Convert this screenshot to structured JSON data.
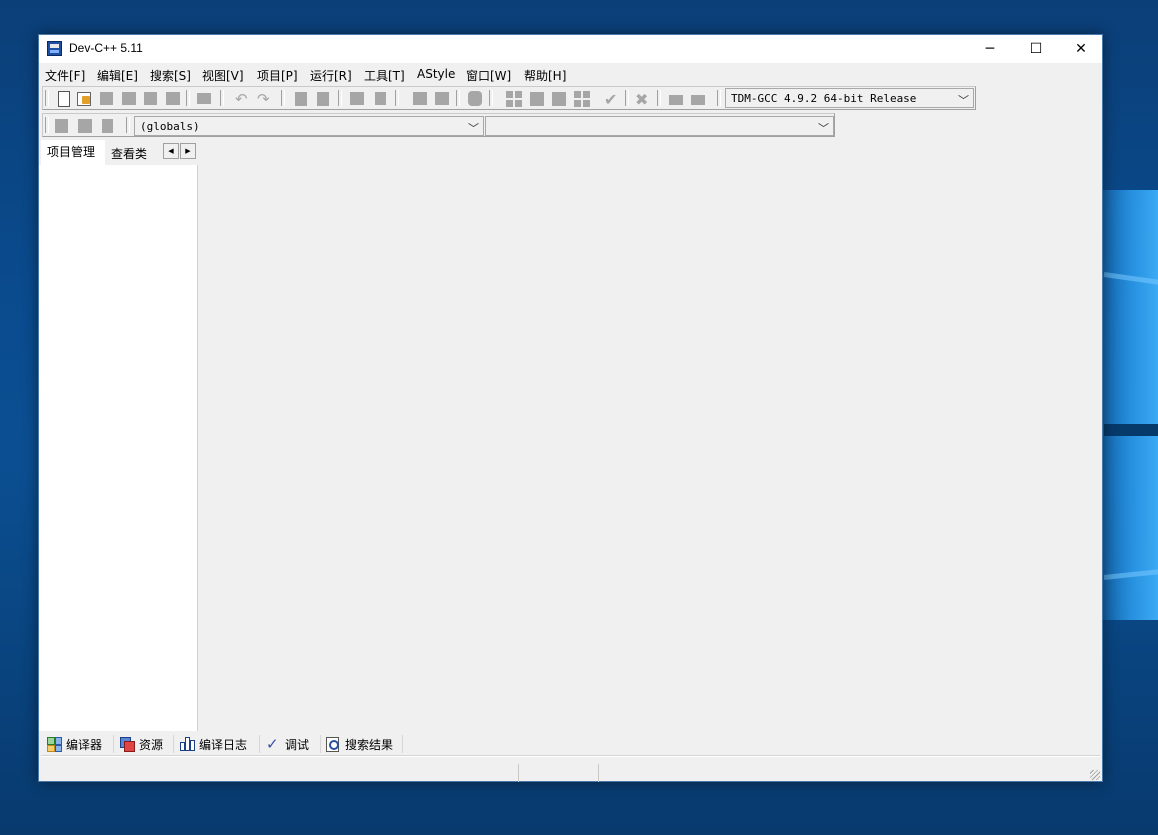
{
  "window": {
    "title": "Dev-C++ 5.11",
    "controls": {
      "minimize": "─",
      "maximize": "☐",
      "close": "✕"
    }
  },
  "menu": [
    {
      "label": "文件[F]"
    },
    {
      "label": "编辑[E]"
    },
    {
      "label": "搜索[S]"
    },
    {
      "label": "视图[V]"
    },
    {
      "label": "项目[P]"
    },
    {
      "label": "运行[R]"
    },
    {
      "label": "工具[T]"
    },
    {
      "label": "AStyle"
    },
    {
      "label": "窗口[W]"
    },
    {
      "label": "帮助[H]"
    }
  ],
  "toolbar": {
    "compiler_select": "TDM-GCC 4.9.2 64-bit Release",
    "scope_select": "(globals)",
    "member_select": ""
  },
  "left_panel": {
    "tabs": [
      "项目管理",
      "查看类"
    ],
    "scroll_left": "◀",
    "scroll_right": "▶"
  },
  "bottom_tabs": [
    {
      "label": "编译器",
      "icon": "compiler-grid-icon"
    },
    {
      "label": "资源",
      "icon": "resources-icon"
    },
    {
      "label": "编译日志",
      "icon": "bar-chart-icon"
    },
    {
      "label": "调试",
      "icon": "checkmark-icon"
    },
    {
      "label": "搜索结果",
      "icon": "search-doc-icon"
    }
  ],
  "colors": {
    "desktop": "#0a4b8e",
    "window_bg": "#f0f0f0",
    "panel_bg": "#ffffff",
    "disabled_icon": "#a6a6a6"
  }
}
